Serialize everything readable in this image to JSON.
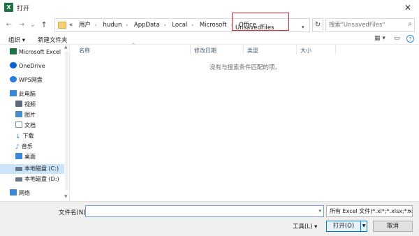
{
  "window": {
    "title": "打开",
    "app_icon_letter": "X",
    "close_glyph": "✕"
  },
  "nav": {
    "back": "←",
    "forward": "→",
    "recent": "⌄",
    "up": "↑"
  },
  "address": {
    "overflow": "«",
    "crumbs": [
      "用户",
      "hudun",
      "AppData",
      "Local",
      "Microsoft",
      "Office"
    ],
    "current": "UnsavedFiles",
    "separator": "›",
    "dropdown_glyph": "▾",
    "refresh_glyph": "↻",
    "highlight_color": "#e0212a"
  },
  "search": {
    "placeholder": "搜索\"UnsavedFiles\"",
    "icon_glyph": "⌕"
  },
  "toolbar": {
    "organize": "组织 ▾",
    "new_folder": "新建文件夹",
    "view_glyph": "▦ ▾",
    "pane_glyph": "▭",
    "help_glyph": "?"
  },
  "sidebar": {
    "items": [
      {
        "label": "Microsoft Excel",
        "icon": "excel-icon",
        "color": "#1e7145"
      },
      {
        "label": "OneDrive",
        "icon": "cloud-icon",
        "color": "#0a64d6"
      },
      {
        "label": "WPS网盘",
        "icon": "cloud-icon",
        "color": "#2a7de1"
      },
      {
        "label": "此电脑",
        "icon": "computer-icon",
        "color": "#3a87d6"
      },
      {
        "label": "视频",
        "icon": "video-icon",
        "color": "#5a6a7a"
      },
      {
        "label": "图片",
        "icon": "picture-icon",
        "color": "#4a8cc9"
      },
      {
        "label": "文档",
        "icon": "document-icon",
        "color": "#7a8a9a"
      },
      {
        "label": "下载",
        "icon": "download-icon",
        "color": "#2a7de1"
      },
      {
        "label": "音乐",
        "icon": "music-icon",
        "color": "#2a7de1"
      },
      {
        "label": "桌面",
        "icon": "desktop-icon",
        "color": "#3a87d6"
      },
      {
        "label": "本地磁盘 (C:)",
        "icon": "drive-icon",
        "color": "#6a7a8a"
      },
      {
        "label": "本地磁盘 (D:)",
        "icon": "drive-icon",
        "color": "#6a7a8a"
      },
      {
        "label": "网络",
        "icon": "network-icon",
        "color": "#3a87d6"
      }
    ],
    "selected": "本地磁盘 (C:)",
    "scroll_up": "▲",
    "scroll_down": "▼"
  },
  "columns": {
    "name": "名称",
    "modified": "修改日期",
    "type": "类型",
    "size": "大小",
    "sort_glyph": "^"
  },
  "content": {
    "empty_message": "没有与搜索条件匹配的项。"
  },
  "footer": {
    "filename_label": "文件名(N):",
    "filename_value": "",
    "filename_dropdown": "▾",
    "file_type": "所有 Excel 文件(*.xl*;*.xlsx;*.xl",
    "file_type_dropdown": "▾",
    "tools": "工具(L) ▾",
    "open": "打开(O)",
    "open_split": "▼",
    "cancel": "取消",
    "grip": "⋰"
  }
}
